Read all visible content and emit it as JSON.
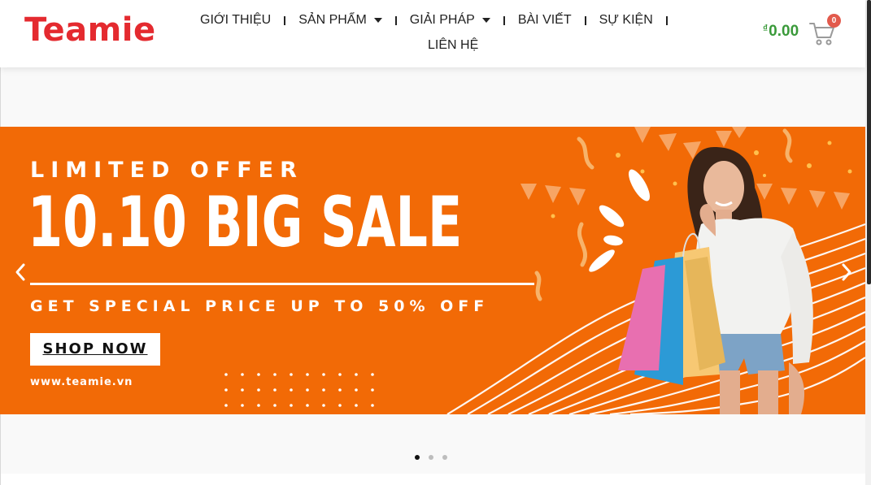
{
  "header": {
    "logo": "Teamie",
    "nav": [
      {
        "label": "GIỚI THIỆU",
        "dropdown": false
      },
      {
        "label": "SẢN PHẨM",
        "dropdown": true
      },
      {
        "label": "GIẢI PHÁP",
        "dropdown": true
      },
      {
        "label": "BÀI VIẾT",
        "dropdown": false
      },
      {
        "label": "SỰ KIỆN",
        "dropdown": false
      },
      {
        "label": "LIÊN HỆ",
        "dropdown": false
      }
    ],
    "cart": {
      "currency": "₫",
      "amount": "0.00",
      "count": "0",
      "icon": "cart-icon"
    }
  },
  "banner": {
    "headline_small": "LIMITED OFFER",
    "headline_big": "10.10 BIG SALE",
    "subline": "GET SPECIAL PRICE UP TO 50% OFF",
    "cta": "SHOP NOW",
    "website": "www.teamie.vn",
    "prev_icon": "chevron-left-icon",
    "next_icon": "chevron-right-icon"
  },
  "carousel": {
    "slides": 3,
    "active_index": 0
  },
  "colors": {
    "brand_red": "#e42a2f",
    "banner_orange": "#f26a06",
    "price_green": "#3a9a3a",
    "badge_red": "#e25a4c"
  }
}
